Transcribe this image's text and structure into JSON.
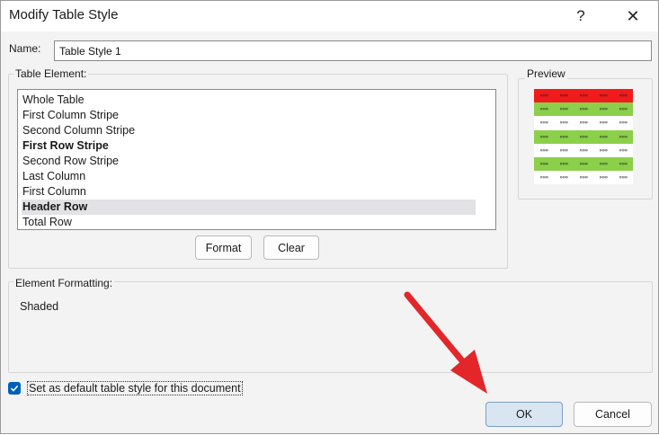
{
  "window": {
    "title": "Modify Table Style",
    "help_glyph": "?",
    "close_glyph": "✕"
  },
  "name": {
    "label": "Name:",
    "value": "Table Style 1"
  },
  "table_element": {
    "label": "Table Element:",
    "items": [
      {
        "label": "Whole Table",
        "bold": false,
        "selected": false
      },
      {
        "label": "First Column Stripe",
        "bold": false,
        "selected": false
      },
      {
        "label": "Second Column Stripe",
        "bold": false,
        "selected": false
      },
      {
        "label": "First Row Stripe",
        "bold": true,
        "selected": false
      },
      {
        "label": "Second Row Stripe",
        "bold": false,
        "selected": false
      },
      {
        "label": "Last Column",
        "bold": false,
        "selected": false
      },
      {
        "label": "First Column",
        "bold": false,
        "selected": false
      },
      {
        "label": "Header Row",
        "bold": true,
        "selected": true
      },
      {
        "label": "Total Row",
        "bold": false,
        "selected": false
      }
    ],
    "format_button": "Format",
    "clear_button": "Clear"
  },
  "preview": {
    "label": "Preview",
    "rows": [
      "red",
      "green",
      "white",
      "green",
      "white",
      "green",
      "white"
    ],
    "cell_text": "»»»",
    "colors": {
      "red": "#f21b1b",
      "green": "#8ccf4a",
      "white": "#ffffff"
    }
  },
  "element_formatting": {
    "label": "Element Formatting:",
    "value": "Shaded"
  },
  "default_checkbox": {
    "label": "Set as default table style for this document",
    "checked": true
  },
  "buttons": {
    "ok": "OK",
    "cancel": "Cancel"
  },
  "colors": {
    "accent": "#005fb8",
    "annotation_arrow": "#e3262a"
  }
}
